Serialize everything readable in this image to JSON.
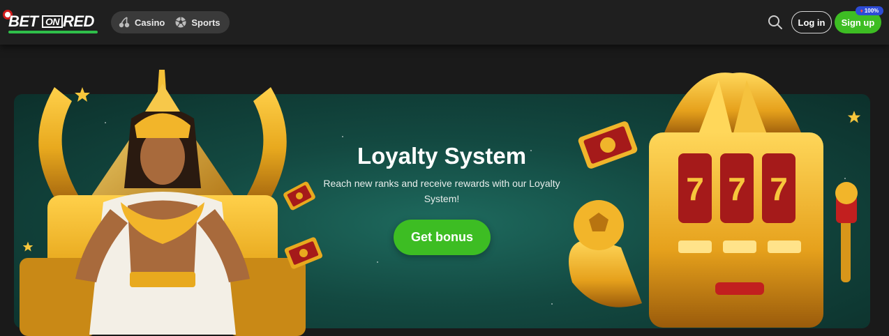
{
  "header": {
    "logo": {
      "part1": "BET",
      "part2": "ON",
      "part3": "RED"
    },
    "nav": [
      {
        "label": "Casino",
        "icon": "cherries-icon"
      },
      {
        "label": "Sports",
        "icon": "soccer-ball-icon"
      }
    ],
    "search_icon": "search-icon",
    "login_label": "Log in",
    "signup_label": "Sign up",
    "signup_badge": "100%"
  },
  "banner": {
    "title": "Loyalty System",
    "text": "Reach new ranks and receive rewards with our Loyalty System!",
    "cta_label": "Get bonus"
  },
  "colors": {
    "brand_green": "#3dbd23",
    "logo_red": "#d11b1b",
    "badge_blue": "#2d4bd6",
    "banner_teal": "#134941",
    "gold": "#e8a91e"
  }
}
